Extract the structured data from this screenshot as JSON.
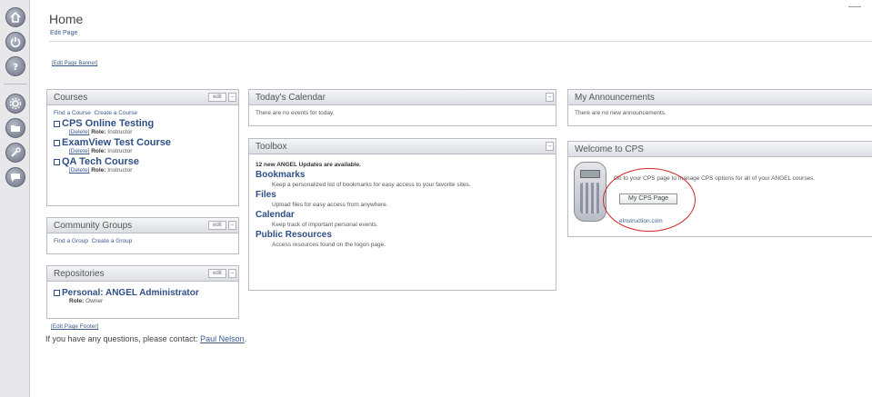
{
  "header": {
    "title": "Home",
    "edit_page": "Edit Page",
    "edit_banner": "[Edit Page Banner]"
  },
  "rail": {
    "icons": [
      "home-icon",
      "power-icon",
      "help-icon",
      "settings-icon",
      "folder-icon",
      "tools-icon",
      "chat-icon"
    ]
  },
  "courses": {
    "title": "Courses",
    "edit": "edit",
    "find": "Find a Course",
    "create": "Create a Course",
    "items": [
      {
        "name": "CPS Online Testing",
        "delete": "[Delete]",
        "role_label": "Role:",
        "role": "Instructor"
      },
      {
        "name": "ExamView Test Course",
        "delete": "[Delete]",
        "role_label": "Role:",
        "role": "Instructor"
      },
      {
        "name": "QA Tech Course",
        "delete": "[Delete]",
        "role_label": "Role:",
        "role": "Instructor"
      }
    ]
  },
  "community": {
    "title": "Community Groups",
    "edit": "edit",
    "find": "Find a Group",
    "create": "Create a Group"
  },
  "repositories": {
    "title": "Repositories",
    "edit": "edit",
    "item": "Personal: ANGEL Administrator",
    "role_label": "Role:",
    "role": "Owner"
  },
  "calendar": {
    "title": "Today's Calendar",
    "empty": "There are no events for today."
  },
  "toolbox": {
    "title": "Toolbox",
    "updates": "12 new ANGEL Updates are available.",
    "tools": [
      {
        "name": "Bookmarks",
        "desc": "Keep a personalized list of bookmarks for easy access to your favorite sites."
      },
      {
        "name": "Files",
        "desc": "Upload files for easy access from anywhere."
      },
      {
        "name": "Calendar",
        "desc": "Keep track of important personal events."
      },
      {
        "name": "Public Resources",
        "desc": "Access resources found on the logon page."
      }
    ]
  },
  "announcements": {
    "title": "My Announcements",
    "empty": "There are no new announcements."
  },
  "cps": {
    "title": "Welcome to CPS",
    "text": "Go to your CPS page to manage CPS options for all of your ANGEL courses.",
    "button": "My CPS Page",
    "link": "eInstruction.com"
  },
  "footer": {
    "edit": "[Edit Page Footer]",
    "contact_text": "If you have any questions, please contact:",
    "contact_name": "Paul Nelson",
    "contact_end": "."
  },
  "colors": {
    "link": "#3a5a8c",
    "panel_border": "#b9bcc6",
    "highlight_oval": "#d12828"
  }
}
